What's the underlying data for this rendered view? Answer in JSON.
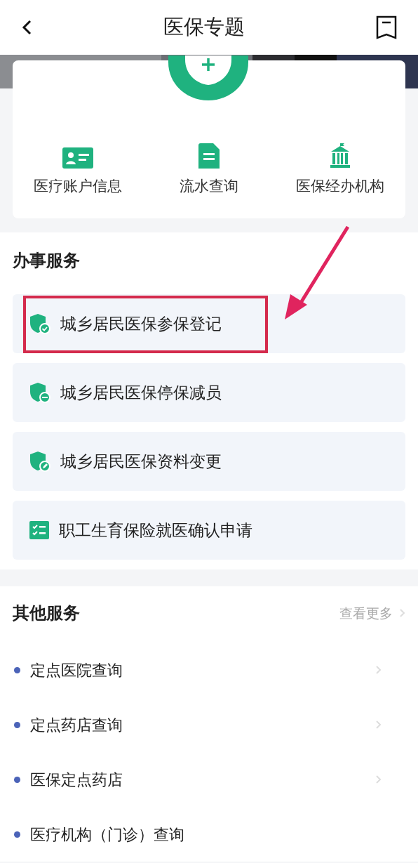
{
  "header": {
    "title": "医保专题"
  },
  "shortcuts": [
    {
      "label": "医疗账户信息",
      "kind": "card"
    },
    {
      "label": "流水查询",
      "kind": "receipt"
    },
    {
      "label": "医保经办机构",
      "kind": "building"
    }
  ],
  "services": {
    "title": "办事服务",
    "items": [
      {
        "label": "城乡居民医保参保登记",
        "kind": "enroll",
        "highlighted": true
      },
      {
        "label": "城乡居民医保停保减员",
        "kind": "stop",
        "highlighted": false
      },
      {
        "label": "城乡居民医保资料变更",
        "kind": "change",
        "highlighted": false
      },
      {
        "label": "职工生育保险就医确认申请",
        "kind": "apply",
        "highlighted": false
      }
    ]
  },
  "other": {
    "title": "其他服务",
    "more": "查看更多",
    "items": [
      {
        "label": "定点医院查询",
        "chevron": true
      },
      {
        "label": "定点药店查询",
        "chevron": true
      },
      {
        "label": "医保定点药店",
        "chevron": true
      },
      {
        "label": "医疗机构（门诊）查询",
        "chevron": false
      }
    ]
  }
}
